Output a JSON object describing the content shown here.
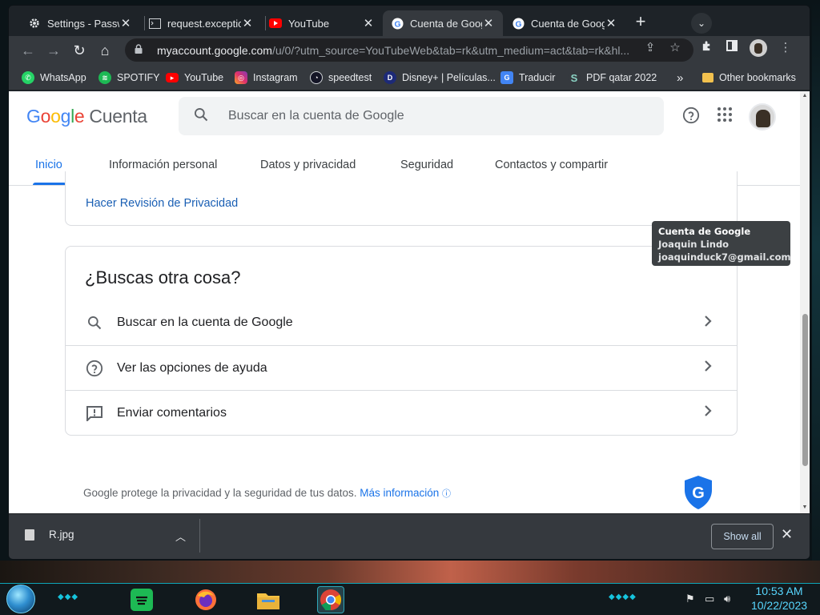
{
  "browser": {
    "tabs": [
      {
        "title": "Settings - Passw",
        "favicon": "gear-icon"
      },
      {
        "title": "request.exceptio",
        "favicon": "terminal-icon"
      },
      {
        "title": "YouTube",
        "favicon": "youtube-icon"
      },
      {
        "title": "Cuenta de Googl",
        "favicon": "google-icon",
        "active": true
      },
      {
        "title": "Cuenta de Goog",
        "favicon": "google-icon"
      }
    ],
    "close_glyph": "✕",
    "new_tab_glyph": "+",
    "url_host": "myaccount.google.com",
    "url_rest": "/u/0/?utm_source=YouTubeWeb&tab=rk&utm_medium=act&tab=rk&hl...",
    "bookmarks": [
      {
        "label": "WhatsApp",
        "icon": "whatsapp-icon"
      },
      {
        "label": "SPOTIFY",
        "icon": "spotify-icon"
      },
      {
        "label": "YouTube",
        "icon": "youtube-icon"
      },
      {
        "label": "Instagram",
        "icon": "instagram-icon"
      },
      {
        "label": "speedtest",
        "icon": "speedtest-icon"
      },
      {
        "label": "Disney+ | Películas...",
        "icon": "disney-icon"
      },
      {
        "label": "Traducir",
        "icon": "translate-icon"
      },
      {
        "label": "PDF qatar 2022",
        "icon": "pdf-icon"
      }
    ],
    "bookmarks_overflow": "»",
    "other_bookmarks": "Other bookmarks"
  },
  "account": {
    "logo_google": "Google",
    "logo_product": "Cuenta",
    "search_placeholder": "Buscar en la cuenta de Google",
    "nav_tabs": [
      {
        "label": "Inicio",
        "active": true
      },
      {
        "label": "Información personal"
      },
      {
        "label": "Datos y privacidad"
      },
      {
        "label": "Seguridad"
      },
      {
        "label": "Contactos y compartir"
      }
    ],
    "privacy_link": "Hacer Revisión de Privacidad",
    "card_title": "¿Buscas otra cosa?",
    "card_rows": [
      {
        "label": "Buscar en la cuenta de Google",
        "icon": "search-icon"
      },
      {
        "label": "Ver las opciones de ayuda",
        "icon": "help-icon"
      },
      {
        "label": "Enviar comentarios",
        "icon": "feedback-icon"
      }
    ],
    "footer_text": "Google protege la privacidad y la seguridad de tus datos. ",
    "footer_link": "Más información",
    "tooltip": {
      "title": "Cuenta de Google",
      "name": "Joaquin Lindo",
      "email": "joaquinduck7@gmail.com"
    }
  },
  "downloads": {
    "file": "R.jpg",
    "show_all": "Show all"
  },
  "taskbar": {
    "time": "10:53 AM",
    "date": "10/22/2023"
  },
  "colors": {
    "accent": "#1a73e8",
    "link": "#1a5fb4",
    "taskbar_accent": "#16c4dd"
  }
}
